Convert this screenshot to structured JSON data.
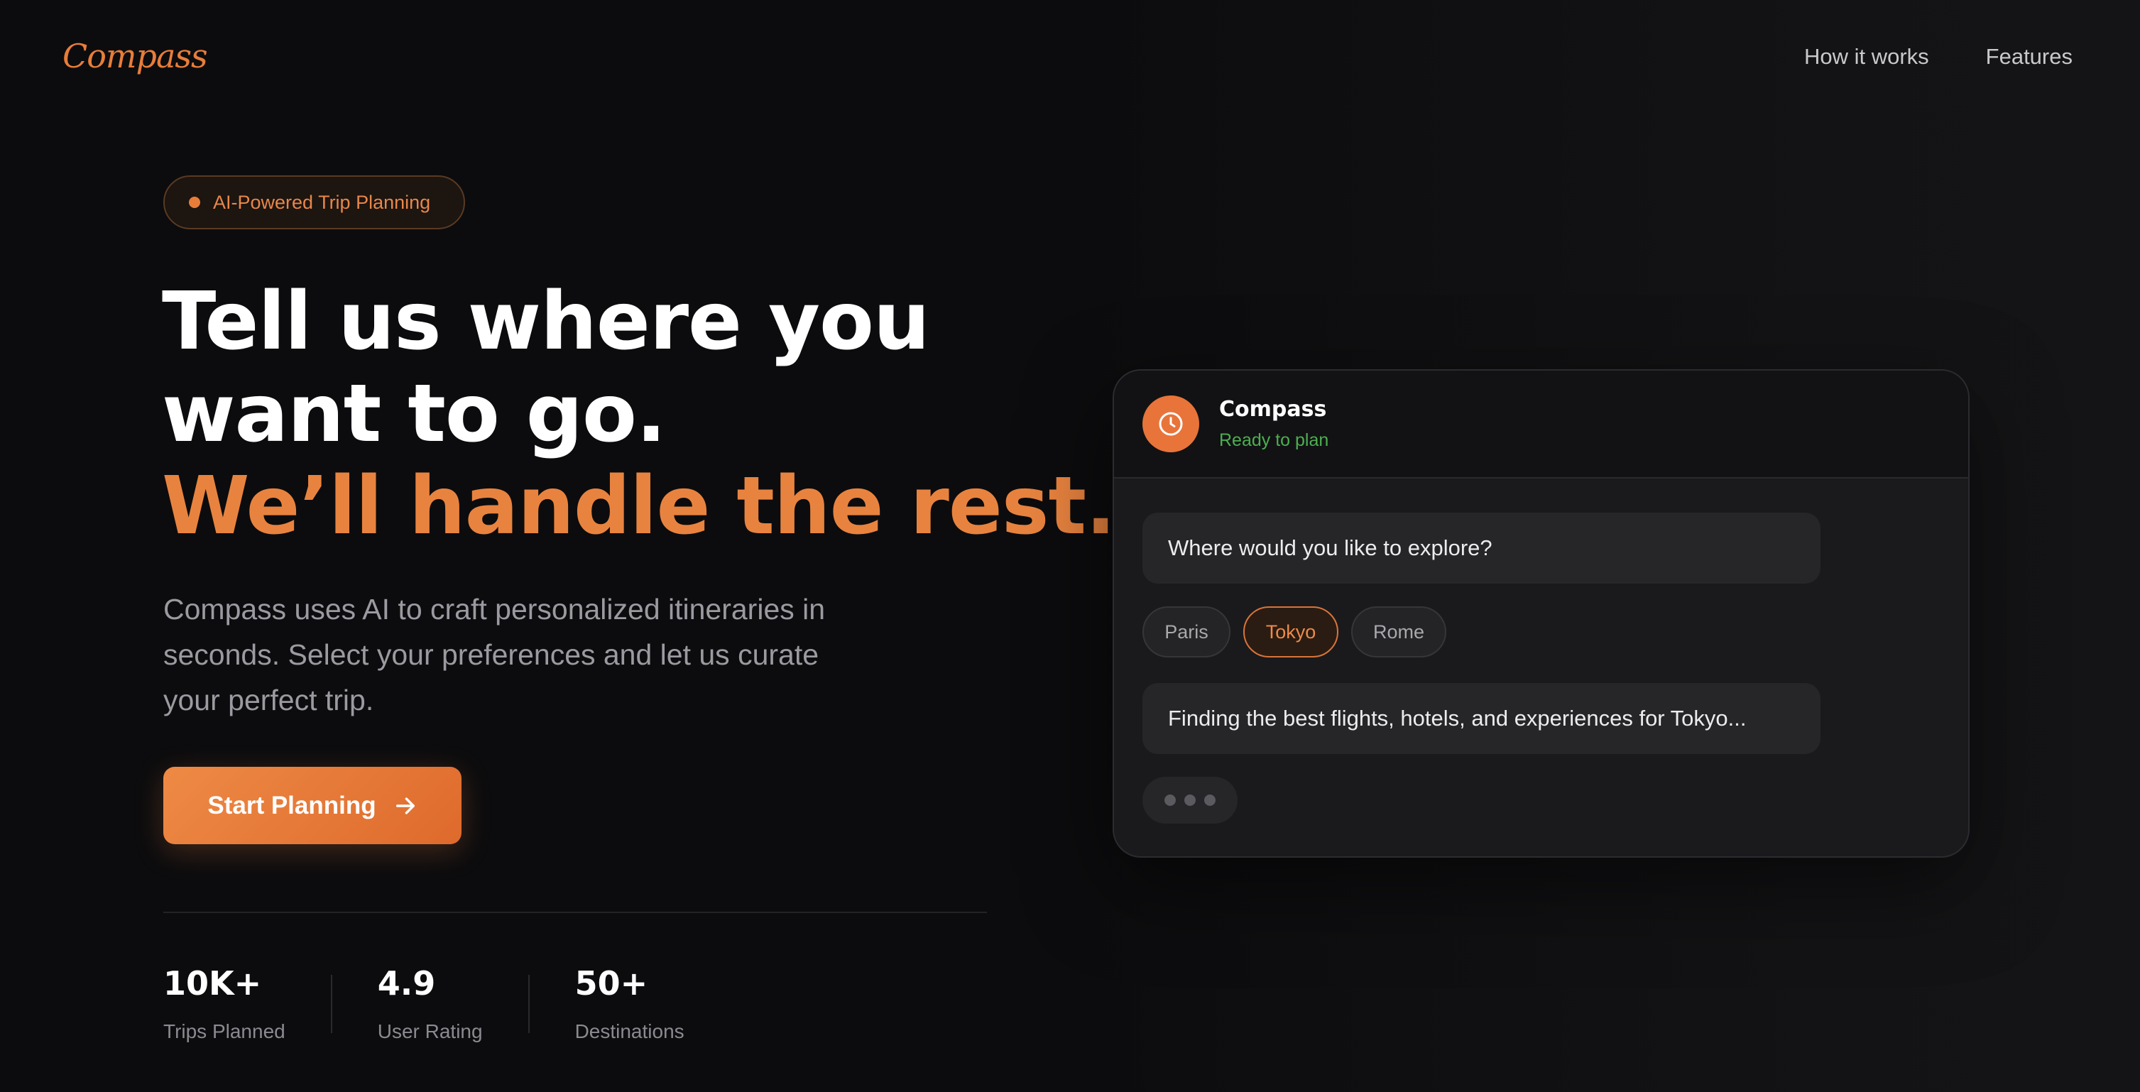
{
  "brand": {
    "logo": "Compass"
  },
  "nav": {
    "items": [
      {
        "label": "How it works"
      },
      {
        "label": "Features"
      }
    ]
  },
  "hero": {
    "badge": "AI-Powered Trip Planning",
    "headline_line1": "Tell us where you",
    "headline_line2": "want to go.",
    "headline_line3": "We’ll handle the rest.",
    "subtext": "Compass uses AI to craft personalized itineraries in seconds. Select your preferences and let us curate your perfect trip.",
    "cta_label": "Start Planning"
  },
  "stats": [
    {
      "value": "10K+",
      "label": "Trips Planned"
    },
    {
      "value": "4.9",
      "label": "User Rating"
    },
    {
      "value": "50+",
      "label": "Destinations"
    }
  ],
  "chat": {
    "assistant_name": "Compass",
    "assistant_status": "Ready to plan",
    "question": "Where would you like to explore?",
    "options": [
      {
        "label": "Paris",
        "selected": false
      },
      {
        "label": "Tokyo",
        "selected": true
      },
      {
        "label": "Rome",
        "selected": false
      }
    ],
    "response": "Finding the best flights, hotels, and experiences for Tokyo..."
  },
  "colors": {
    "accent": "#e87d3a",
    "background": "#0c0c0e",
    "status_green": "#4caf50"
  },
  "icons": {
    "avatar": "clock-icon",
    "cta": "arrow-right-icon",
    "badge": "dot-icon",
    "typing": "typing-dots-icon"
  }
}
